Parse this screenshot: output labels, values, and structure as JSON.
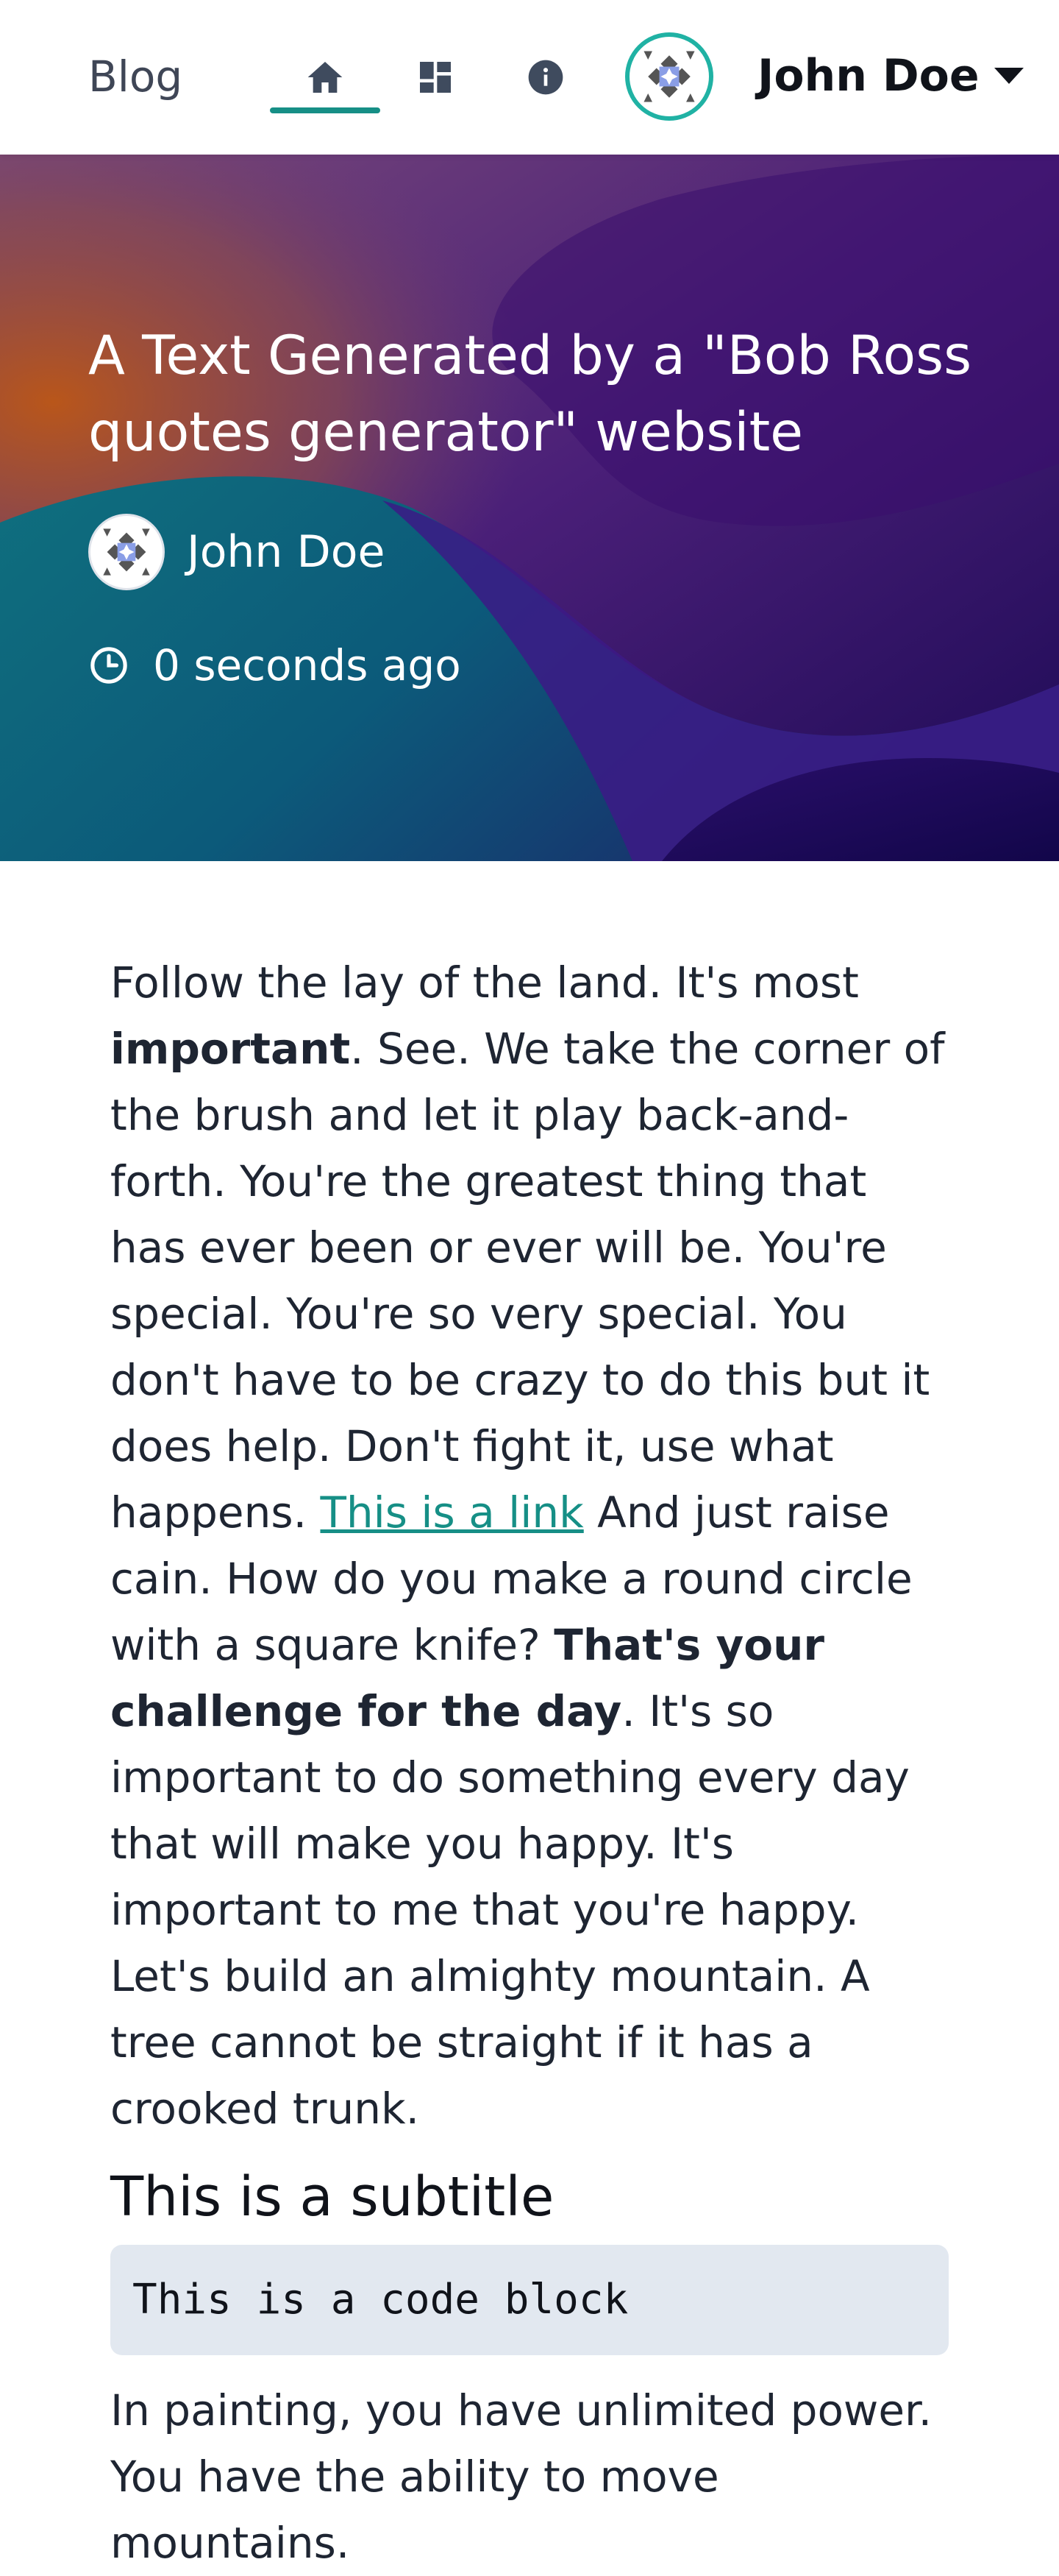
{
  "nav": {
    "brand": "Blog",
    "user_name": "John Doe",
    "icons": [
      "home-icon",
      "dashboard-icon",
      "info-icon"
    ]
  },
  "hero": {
    "title": "A Text Generated by a \"Bob Ross quotes generator\" website",
    "author": "John Doe",
    "time": "0 seconds ago"
  },
  "article": {
    "p1_a": "Follow the lay of the land. It's most ",
    "p1_bold1": "important",
    "p1_b": ". See. We take the corner of the brush and let it play back-and-forth. You're the greatest thing that has ever been or ever will be. You're special. You're so very special. You don't have to be crazy to do this but it does help. Don't fight it, use what happens. ",
    "p1_link": "This is a link",
    "p1_c": " And just raise cain. How do you make a round circle with a square knife? ",
    "p1_bold2": "That's your challenge for the day",
    "p1_d": ". It's so important to do something every day that will make you happy. It's important to me that you're happy. Let's build an almighty mountain. A tree cannot be straight if it has a crooked trunk.",
    "subtitle": "This is a subtitle",
    "code": "This is a code block",
    "p2": "In painting, you have unlimited power. You have the ability to move mountains."
  },
  "colors": {
    "accent": "#168f86",
    "avatar_ring": "#20b2a4",
    "code_bg": "#e2e8f0",
    "hero_purple": "#3a0a6e",
    "hero_teal": "#0b6c7c"
  }
}
